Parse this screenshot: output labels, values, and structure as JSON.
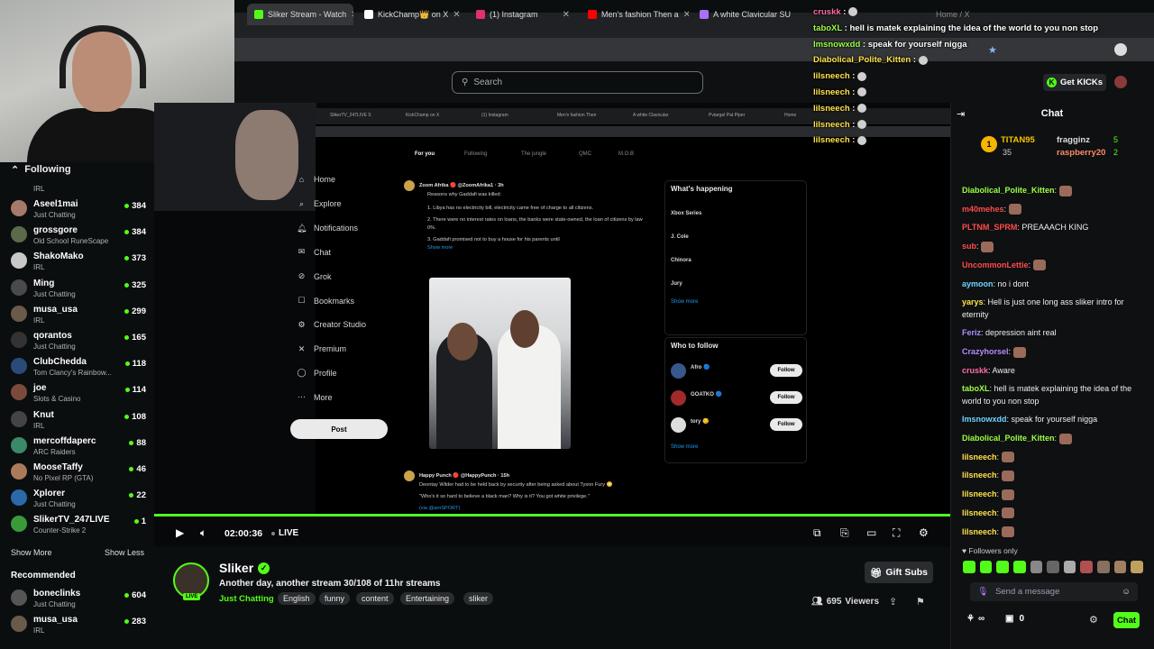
{
  "browser": {
    "tabs": [
      {
        "label": "Sliker Stream - Watch",
        "color": "#53fc18"
      },
      {
        "label": "KickChamp👑 on X",
        "color": "#ffffff"
      },
      {
        "label": "(1) Instagram",
        "color": "#e1306c"
      },
      {
        "label": "Men's fashion Then a",
        "color": "#ff0000"
      },
      {
        "label": "A white Clavicular SU",
        "color": "#a970ff"
      },
      {
        "label": "Home / X",
        "color": "#ffffff"
      }
    ]
  },
  "header": {
    "search_placeholder": "Search",
    "get_kicks_label": "Get KICKs"
  },
  "sidebar": {
    "following_label": "Following",
    "top_category": "IRL",
    "items": [
      {
        "name": "Aseel1mai",
        "category": "Just Chatting",
        "viewers": "384",
        "color": "#a67a6a"
      },
      {
        "name": "grossgore",
        "category": "Old School RuneScape",
        "viewers": "384",
        "color": "#5a6a4a"
      },
      {
        "name": "ShakoMako",
        "category": "IRL",
        "viewers": "373",
        "color": "#c8c8c8"
      },
      {
        "name": "Ming",
        "category": "Just Chatting",
        "viewers": "325",
        "color": "#4a4a4a"
      },
      {
        "name": "musa_usa",
        "category": "IRL",
        "viewers": "299",
        "color": "#6a5a4a"
      },
      {
        "name": "qorantos",
        "category": "Just Chatting",
        "viewers": "165",
        "color": "#333333"
      },
      {
        "name": "ClubChedda",
        "category": "Tom Clancy's Rainbow...",
        "viewers": "118",
        "color": "#2a4a7a"
      },
      {
        "name": "joe",
        "category": "Slots & Casino",
        "viewers": "114",
        "color": "#7a4a3a"
      },
      {
        "name": "Knut",
        "category": "IRL",
        "viewers": "108",
        "color": "#444444"
      },
      {
        "name": "mercoffdaperc",
        "category": "ARC Raiders",
        "viewers": "88",
        "color": "#3a8a6a"
      },
      {
        "name": "MooseTaffy",
        "category": "No Pixel RP (GTA)",
        "viewers": "46",
        "color": "#aa7a5a"
      },
      {
        "name": "Xplorer",
        "category": "Just Chatting",
        "viewers": "22",
        "color": "#2a6aaa"
      },
      {
        "name": "SlikerTV_247LIVE",
        "category": "Counter-Strike 2",
        "viewers": "1",
        "color": "#3a9a3a"
      }
    ],
    "show_more": "Show More",
    "show_less": "Show Less",
    "recommended_label": "Recommended",
    "recommended": [
      {
        "name": "boneclinks",
        "category": "Just Chatting",
        "viewers": "604",
        "color": "#555555"
      },
      {
        "name": "musa_usa",
        "category": "IRL",
        "viewers": "283",
        "color": "#6a5a4a"
      }
    ]
  },
  "screen_share": {
    "inner_tabs": [
      "SlikerTV_247LIVE S",
      "KickChamp on X",
      "(1) Instagram",
      "Men's fashion Then",
      "A white Clavicular",
      "Pvtargel Pat Piper",
      "Home"
    ],
    "x_nav": [
      "Home",
      "Explore",
      "Notifications",
      "Chat",
      "Grok",
      "Bookmarks",
      "Creator Studio",
      "Premium",
      "Profile",
      "More"
    ],
    "post_label": "Post",
    "feed_tabs": [
      "For you",
      "Following",
      "The jungle",
      "QMC",
      "M.O.B"
    ],
    "tweet1": {
      "author": "Zoom Afrika 🔴 @ZoomAfrika1 · 3h",
      "lead": "Reasons why Gaddafi was killed:",
      "p1": "1. Libya has no electricity bill, electricity came free of charge to all citizens.",
      "p2": "2. There were no interest rates on loans, the banks were state-owned, the loan of citizens by law 0%.",
      "p3": "3. Gaddafi promised not to buy a house for his parents until",
      "show_more": "Show more"
    },
    "tweet2": {
      "author": "Happy Punch 🔴 @HappyPunch · 15h",
      "text": "Deontay Wilder had to be held back by security after being asked about Tyson Fury 😳",
      "quote": "\"Who's it so hard to believe a black man? Why is it? You got white privilege.\"",
      "via": "(via @arnSPORT)"
    },
    "whats_happening": {
      "title": "What's happening",
      "items": [
        "Xbox Series",
        "J. Cole",
        "Chinora",
        "Jury"
      ],
      "show_more": "Show more"
    },
    "who_to_follow": {
      "title": "Who to follow",
      "people": [
        {
          "name": "Afro 🔵",
          "follow": "Follow"
        },
        {
          "name": "GOATKO 🔵",
          "follow": "Follow"
        },
        {
          "name": "tory 😏",
          "follow": "Follow"
        }
      ],
      "show_more": "Show more"
    }
  },
  "overlay_chat": [
    {
      "user": "cruskk",
      "text": "",
      "user_color": "#ff6aa8"
    },
    {
      "user": "taboXL",
      "text": "hell is matek explaining the idea of the world to you non stop",
      "user_color": "#9cff45"
    },
    {
      "user": "Imsnowxdd",
      "text": "speak for yourself nigga",
      "user_color": "#9cff45"
    },
    {
      "user": "Diabolical_Polite_Kitten",
      "text": "",
      "user_color": "#ffe24a"
    },
    {
      "user": "lilsneech",
      "text": "",
      "user_color": "#ffe24a"
    },
    {
      "user": "lilsneech",
      "text": "",
      "user_color": "#ffe24a"
    },
    {
      "user": "lilsneech",
      "text": "",
      "user_color": "#ffe24a"
    },
    {
      "user": "lilsneech",
      "text": "",
      "user_color": "#ffe24a"
    },
    {
      "user": "lilsneech",
      "text": "",
      "user_color": "#ffe24a"
    }
  ],
  "player": {
    "time": "02:00:36",
    "live_label": "LIVE",
    "progress_fraction": 1.0
  },
  "stream": {
    "streamer": "Sliker",
    "live_badge": "LIVE",
    "title": "Another day, another stream 30/108 of 11hr streams",
    "category": "Just Chatting",
    "tags": [
      "English",
      "funny",
      "content",
      "Entertaining",
      "sliker"
    ],
    "gift_subs_label": "Gift Subs",
    "viewers": "695",
    "viewers_label": "Viewers"
  },
  "chat": {
    "title": "Chat",
    "leaderboard": [
      {
        "name": "TITAN95",
        "count": "35"
      },
      {
        "name": "fragginz",
        "count": "5"
      },
      {
        "name": "raspberry20",
        "count": "2"
      }
    ],
    "messages": [
      {
        "user": "Diabolical_Polite_Kitten",
        "text": "",
        "color": "#9cff45"
      },
      {
        "user": "m40mehes",
        "text": "",
        "color": "#ff4b4b"
      },
      {
        "user": "PLTNM_SPRM",
        "text": "PREAAACH KING",
        "color": "#ff4b4b"
      },
      {
        "user": "sub",
        "text": "",
        "color": "#ff4b4b"
      },
      {
        "user": "UncommonLettie",
        "text": "",
        "color": "#ff4b4b"
      },
      {
        "user": "aymoon",
        "text": "no i dont",
        "color": "#6fd3ff"
      },
      {
        "user": "yarys",
        "text": "Hell is just one long ass sliker intro for eternity",
        "color": "#ffe24a"
      },
      {
        "user": "Feriz",
        "text": "depression aint real",
        "color": "#b28cff"
      },
      {
        "user": "Crazyhorsel",
        "text": "",
        "color": "#b28cff"
      },
      {
        "user": "cruskk",
        "text": "Aware",
        "color": "#ff6aa8"
      },
      {
        "user": "taboXL",
        "text": "hell is matek explaining the idea of the world to you non stop",
        "color": "#9cff45"
      },
      {
        "user": "Imsnowxdd",
        "text": "speak for yourself nigga",
        "color": "#6fd3ff"
      },
      {
        "user": "Diabolical_Polite_Kitten",
        "text": "",
        "color": "#9cff45"
      },
      {
        "user": "lilsneech",
        "text": "",
        "color": "#ffe24a"
      },
      {
        "user": "lilsneech",
        "text": "",
        "color": "#ffe24a"
      },
      {
        "user": "lilsneech",
        "text": "",
        "color": "#ffe24a"
      },
      {
        "user": "lilsneech",
        "text": "",
        "color": "#ffe24a"
      },
      {
        "user": "lilsneech",
        "text": "",
        "color": "#ffe24a"
      }
    ],
    "followers_only": "Followers only",
    "input_placeholder": "Send a message",
    "points": "∞",
    "gifts": "0",
    "send_label": "Chat"
  },
  "colors": {
    "accent": "#53fc18",
    "background": "#0b0e0f"
  }
}
